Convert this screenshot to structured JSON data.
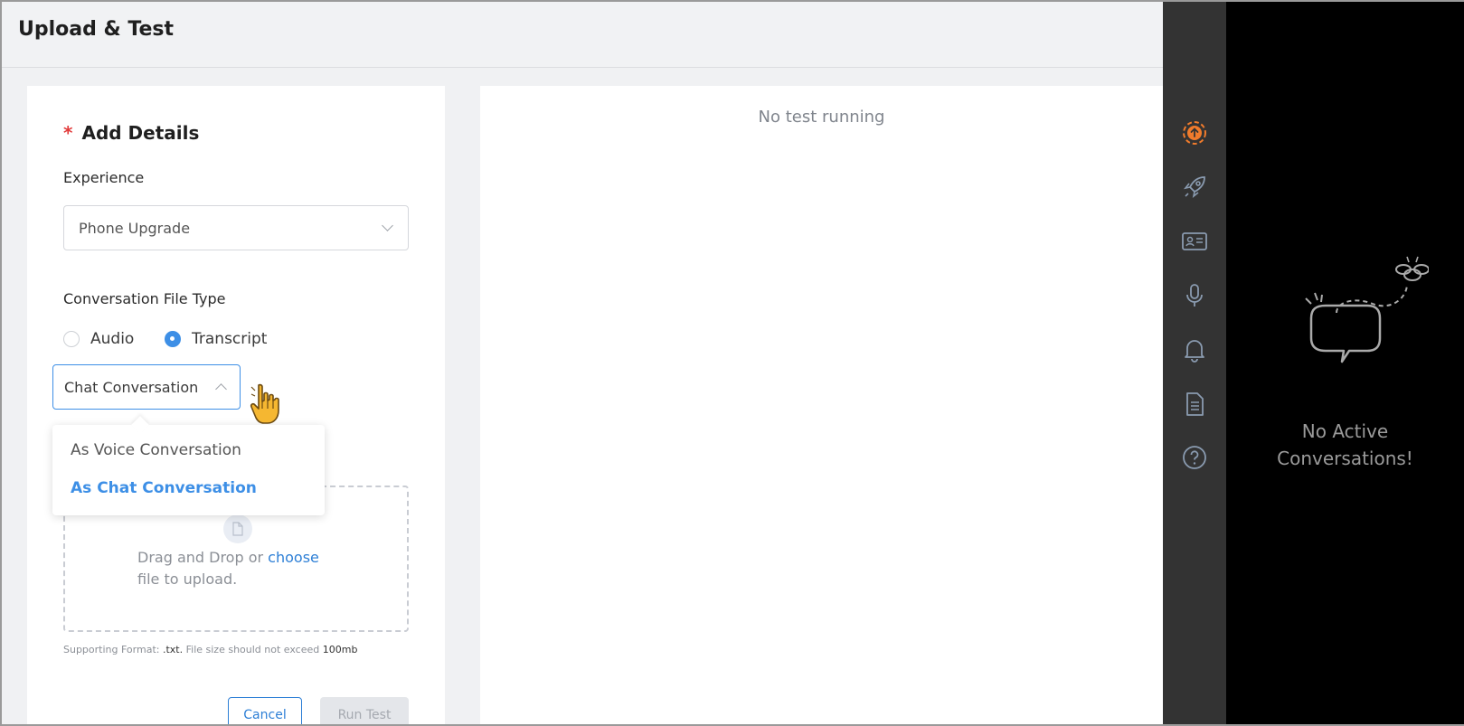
{
  "header": {
    "title": "Upload & Test"
  },
  "form": {
    "required_mark": "*",
    "section_title": "Add Details",
    "experience_label": "Experience",
    "experience_value": "Phone Upgrade",
    "file_type_label": "Conversation File Type",
    "radio_audio": "Audio",
    "radio_transcript": "Transcript",
    "selected_radio": "Transcript",
    "conversation_select_value": "Chat Conversation",
    "dropdown_options": [
      "As Voice Conversation",
      "As Chat Conversation"
    ],
    "dropdown_selected": "As Chat Conversation",
    "dropzone_text_1": "Drag and Drop or",
    "dropzone_link": "choose",
    "dropzone_text_2": "file to upload.",
    "support_prefix": "Supporting Format:",
    "support_format": ".txt.",
    "support_mid": "File size should not exceed",
    "support_size": "100mb",
    "cancel_label": "Cancel",
    "run_label": "Run Test"
  },
  "results": {
    "message": "No test running"
  },
  "rail": {
    "icons": [
      "upload-icon",
      "rocket-icon",
      "id-card-icon",
      "microphone-icon",
      "bell-icon",
      "document-icon",
      "help-icon"
    ],
    "active_color": "#f07b2c",
    "inactive_color": "#8a9bb0"
  },
  "conversations": {
    "empty_line_1": "No Active",
    "empty_line_2": "Conversations!"
  }
}
